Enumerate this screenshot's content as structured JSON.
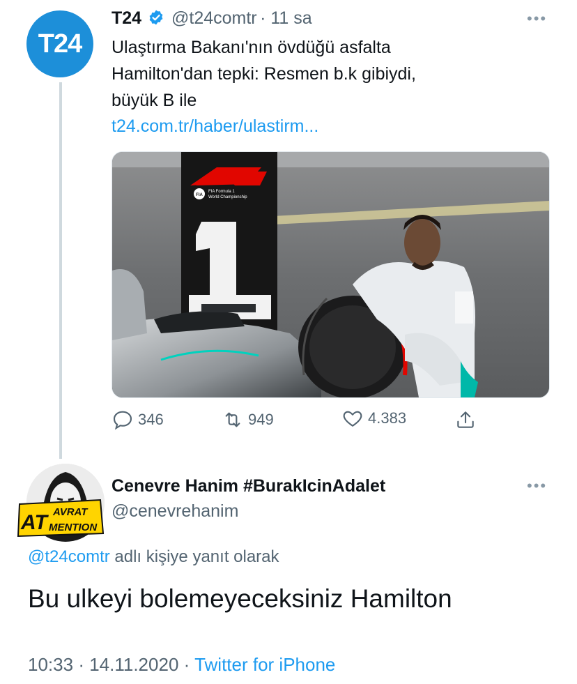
{
  "tweet": {
    "avatar_text": "T24",
    "name": "T24",
    "handle": "@t24comtr",
    "time": "11 sa",
    "text_lines": [
      "Ulaştırma Bakanı'nın övdüğü asfalta",
      "Hamilton'dan tepki: Resmen b.k gibiydi,",
      "büyük B ile"
    ],
    "link": "t24.com.tr/haber/ulastirm...",
    "photo": {
      "board_caption_line1": "FIA Formula 1",
      "board_caption_line2": "World Championship",
      "board_number": "1",
      "fia_badge": "FIA"
    },
    "actions": {
      "replies": "346",
      "retweets": "949",
      "likes": "4.383"
    }
  },
  "reply": {
    "name": "Cenevre Hanim #BurakIcinAdalet",
    "handle": "@cenevrehanim",
    "avatar_text_1": "AT",
    "avatar_text_2": "AVRAT",
    "avatar_text_3": "MENTION",
    "replying_mention": "@t24comtr",
    "replying_suffix": "adlı kişiye yanıt olarak",
    "text": "Bu ulkeyi bolemeyeceksiniz Hamilton",
    "time": "10:33",
    "date": "14.11.2020",
    "source": "Twitter for iPhone"
  },
  "colors": {
    "accent": "#1d9bf0",
    "t24_brand": "#1d8fd9",
    "secondary_text": "#536471"
  }
}
